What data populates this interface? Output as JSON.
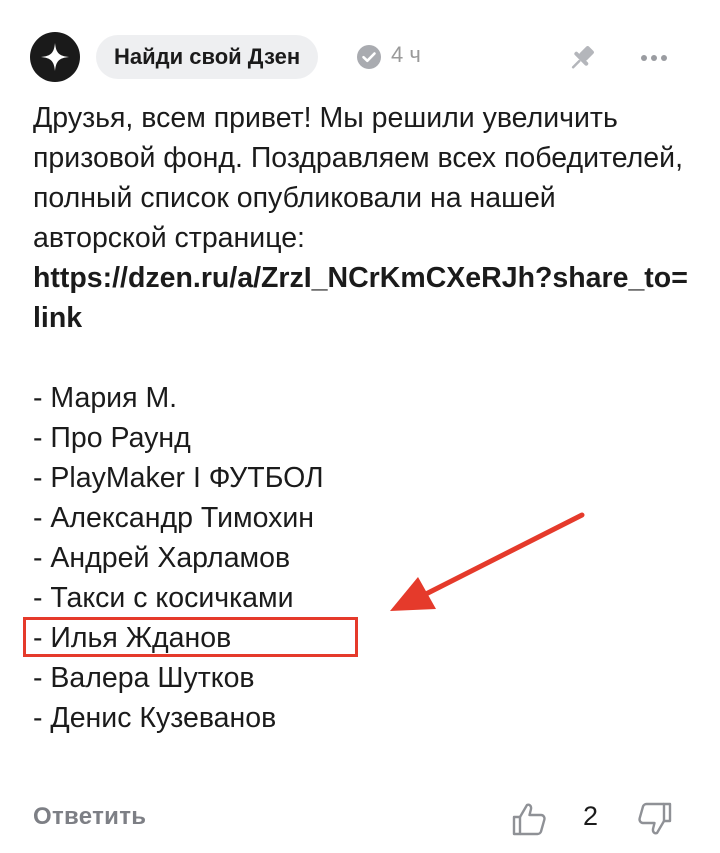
{
  "header": {
    "avatar_icon": "sparkle-star-icon",
    "channel_name": "Найди свой Дзен",
    "verified_icon": "check-circle-icon",
    "time": "4 ч",
    "pin_icon": "pin-icon",
    "more_icon": "more-dots-icon"
  },
  "post": {
    "paragraph": "Друзья, всем привет! Мы решили увеличить призовой фонд. Поздравляем всех победителей, полный список опубликовали на нашей авторской странице:",
    "link": "https://dzen.ru/a/ZrzI_NCrKmCXeRJh?share_to=link",
    "winners": [
      "- Мария М.",
      "- Про Раунд",
      "- PlayMaker I ФУТБОЛ",
      "- Александр Тимохин",
      "- Андрей Харламов",
      "- Такси с косичками",
      "- Илья Жданов",
      "- Валера Шутков",
      "- Денис Кузеванов"
    ]
  },
  "annotation": {
    "highlight_color": "#e53a2b"
  },
  "footer": {
    "reply_label": "Ответить",
    "like_icon": "thumbs-up-icon",
    "like_count": "2",
    "dislike_icon": "thumbs-down-icon"
  }
}
